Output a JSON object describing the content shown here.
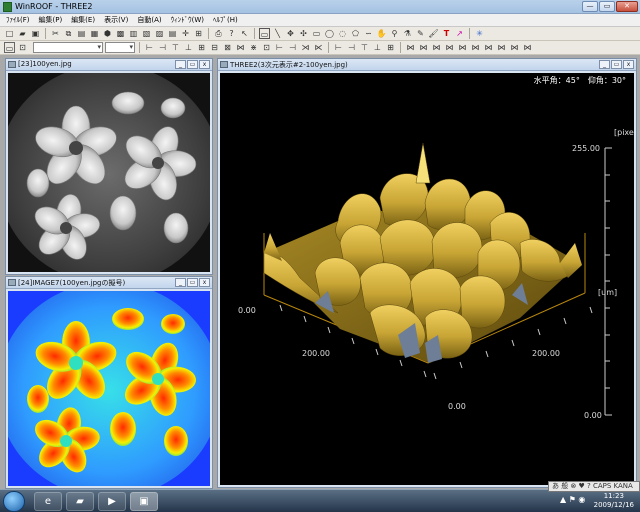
{
  "window": {
    "title": "WinROOF - THREE2"
  },
  "menu": [
    "ﾌｧｲﾙ(F)",
    "編集(P)",
    "編集(E)",
    "表示(V)",
    "自動(A)",
    "ｳｨﾝﾄﾞｳ(W)",
    "ﾍﾙﾌﾟ(H)"
  ],
  "windows": {
    "img23": {
      "title": "[23]100yen.jpg"
    },
    "img24": {
      "title": "[24]IMAGE7(100yen.jpgの擬号)"
    },
    "three": {
      "title": "THREE2(3次元表示#2-100yen.jpg)",
      "angle_text": "水平角：45°　仰角：30°",
      "z_unit": "[pixel]",
      "z_max": "255.00",
      "z_zero": "0.00",
      "left_zero": "0.00",
      "x_200": "200.00",
      "x_zero": "0.00",
      "y_200": "200.00",
      "y_unit": "[um]"
    }
  },
  "taskbar": {
    "ime": "あ 般 ⊗ ♥ ? CAPS KANA",
    "clock_time": "11:23",
    "clock_date": "2009/12/16"
  },
  "colors": {
    "surface_gold": "#c8a535",
    "axis_orange": "#b8860b"
  }
}
